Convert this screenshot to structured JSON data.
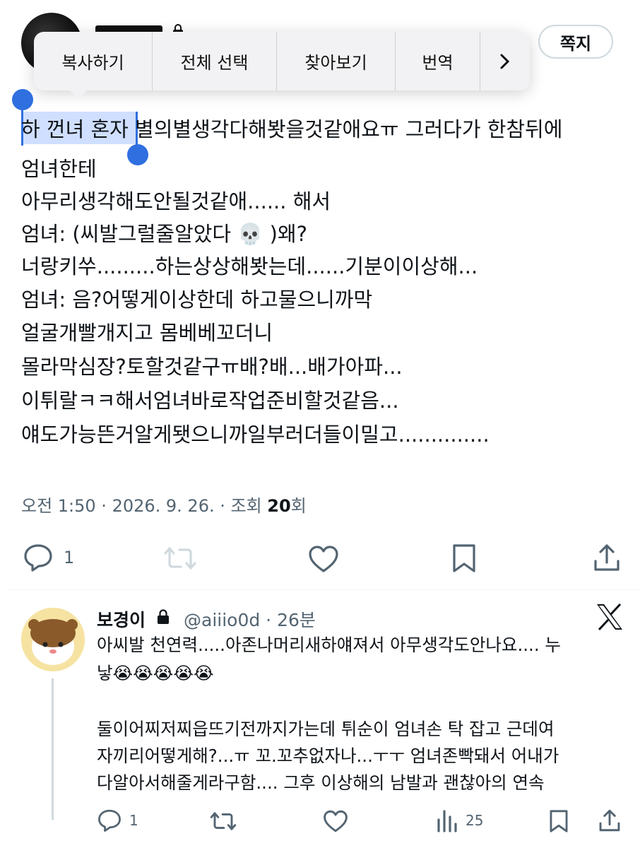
{
  "header": {
    "dm_button": "쪽지"
  },
  "context_menu": {
    "items": [
      "복사하기",
      "전체 선택",
      "찾아보기",
      "번역"
    ]
  },
  "tweet": {
    "selected_text": "하 껀녀 혼자",
    "first_line_rest": " 별의별생각다해봣을것같애요ㅠ 그러다가 한참뒤에",
    "lines": [
      "엄녀한테",
      "아무리생각해도안될것같애...... 해서",
      "엄녀: (씨발그럴줄알았다 💀 )왜?",
      "너랑키쑤.........하는상상해봣는데......기분이이상해...",
      "엄녀: 음?어떻게이상한데 하고물으니까막",
      "얼굴개빨개지고 몸베베꼬더니",
      "몰라막심장?토할것같구ㅠ배?배...배가아파...",
      "이튀랄ㅋㅋ해서엄녀바로작업준비할것같음...",
      "얘도가능뜬거알게됏으니까일부러더들이밀고.............."
    ],
    "meta_prefix": "오전 1:50 · 2026. 9. 26. · 조회 ",
    "views": "20",
    "meta_suffix": "회",
    "reply_count": "1"
  },
  "reply": {
    "name": "보경이",
    "handle": "@aiiio0d · 26분",
    "lines": [
      "아씨발 천연력.....아존나머리새하얘져서 아무생각도안나요.... 누",
      "낳😭😭😭😭😭",
      "",
      "둘이어찌저찌읍뜨기전까지가는데 튀순이 엄녀손 탁 잡고 근데여",
      "자끼리어떻게해?...ㅠ 꼬.꼬추없자나...ㅜㅜ 엄녀존빡돼서 어내가",
      "다알아서해줄게라구함.... 그후 이상해의 남발과 괜찮아의 연속"
    ],
    "reply_count": "1",
    "view_count": "25"
  },
  "colors": {
    "text": "#0f1419",
    "secondary": "#536471",
    "selection": "#2f6fe0"
  }
}
